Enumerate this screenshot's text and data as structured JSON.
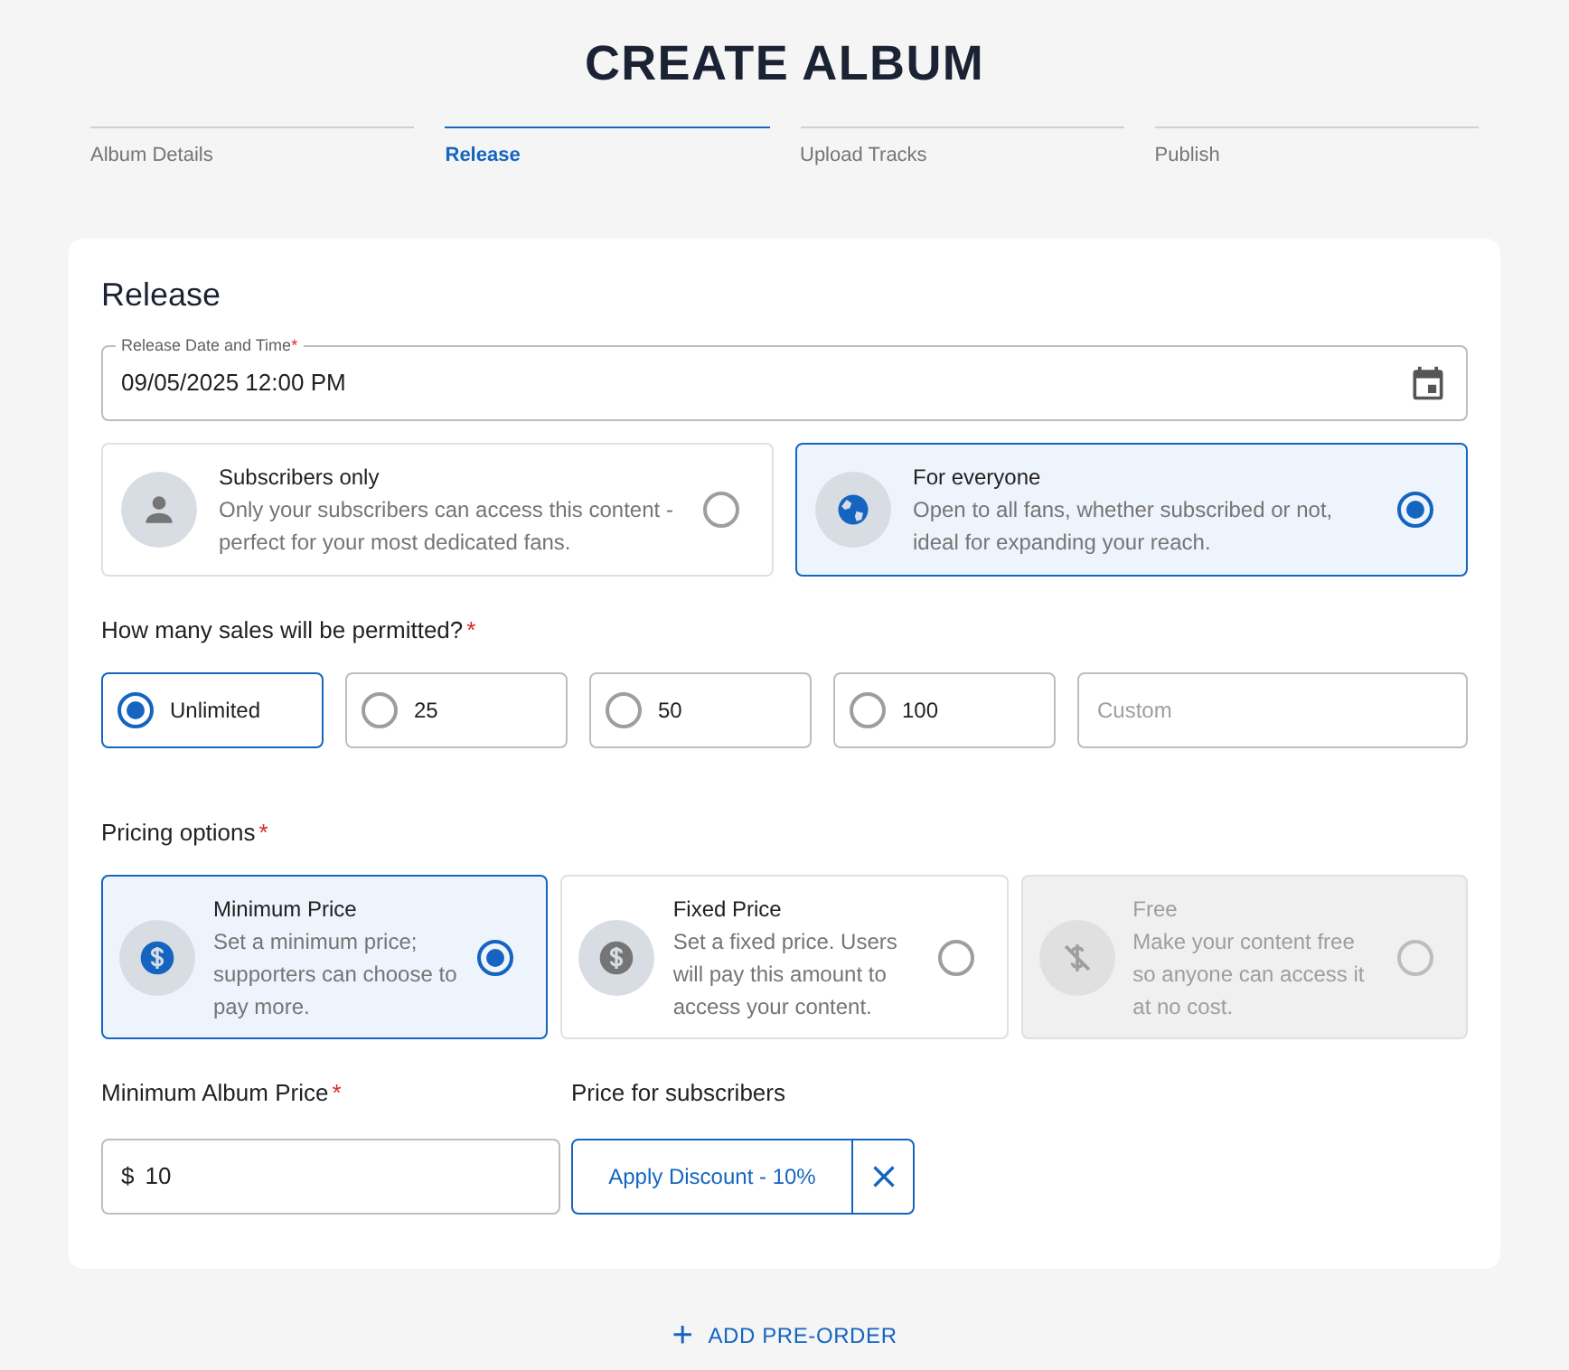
{
  "title": "CREATE ALBUM",
  "steps": [
    {
      "label": "Album Details",
      "selected": false
    },
    {
      "label": "Release",
      "selected": true
    },
    {
      "label": "Upload Tracks",
      "selected": false
    },
    {
      "label": "Publish",
      "selected": false
    }
  ],
  "section_title": "Release",
  "release_date": {
    "label": "Release Date and Time",
    "mark": "*",
    "value": "09/05/2025 12:00 PM"
  },
  "audience": [
    {
      "kind": "person",
      "title": "Subscribers only",
      "description": "Only your subscribers can access this content - perfect for your most dedicated fans.",
      "selected": false
    },
    {
      "kind": "globe",
      "title": "For everyone",
      "description": "Open to all fans, whether subscribed or not, ideal for expanding your reach.",
      "selected": true
    }
  ],
  "sales": {
    "label": "How many sales will be permitted?",
    "mark": "*",
    "options": [
      {
        "label": "Unlimited",
        "selected": true
      },
      {
        "label": "25",
        "selected": false
      },
      {
        "label": "50",
        "selected": false
      },
      {
        "label": "100",
        "selected": false
      }
    ],
    "custom": {
      "placeholder": "Custom"
    }
  },
  "pricing": {
    "label": "Pricing options",
    "mark": "*",
    "options": [
      {
        "kind": "dollar",
        "title": "Minimum Price",
        "description": "Set a minimum price; supporters can choose to pay more.",
        "selected": true,
        "disabled": false
      },
      {
        "kind": "dollar",
        "title": "Fixed Price",
        "description": "Set a fixed price. Users will pay this amount to access your content.",
        "selected": false,
        "disabled": false
      },
      {
        "kind": "no-dollar",
        "title": "Free",
        "description": "Make your content free so anyone can access it at no cost.",
        "selected": false,
        "disabled": true
      }
    ]
  },
  "min_price": {
    "label": "Minimum Album Price",
    "mark": "*",
    "currency": "$",
    "value": "10"
  },
  "subscriber_price": {
    "label": "Price for subscribers",
    "button": "Apply Discount - 10%"
  },
  "add_preorder": {
    "icon": "+",
    "label": "ADD PRE-ORDER"
  }
}
